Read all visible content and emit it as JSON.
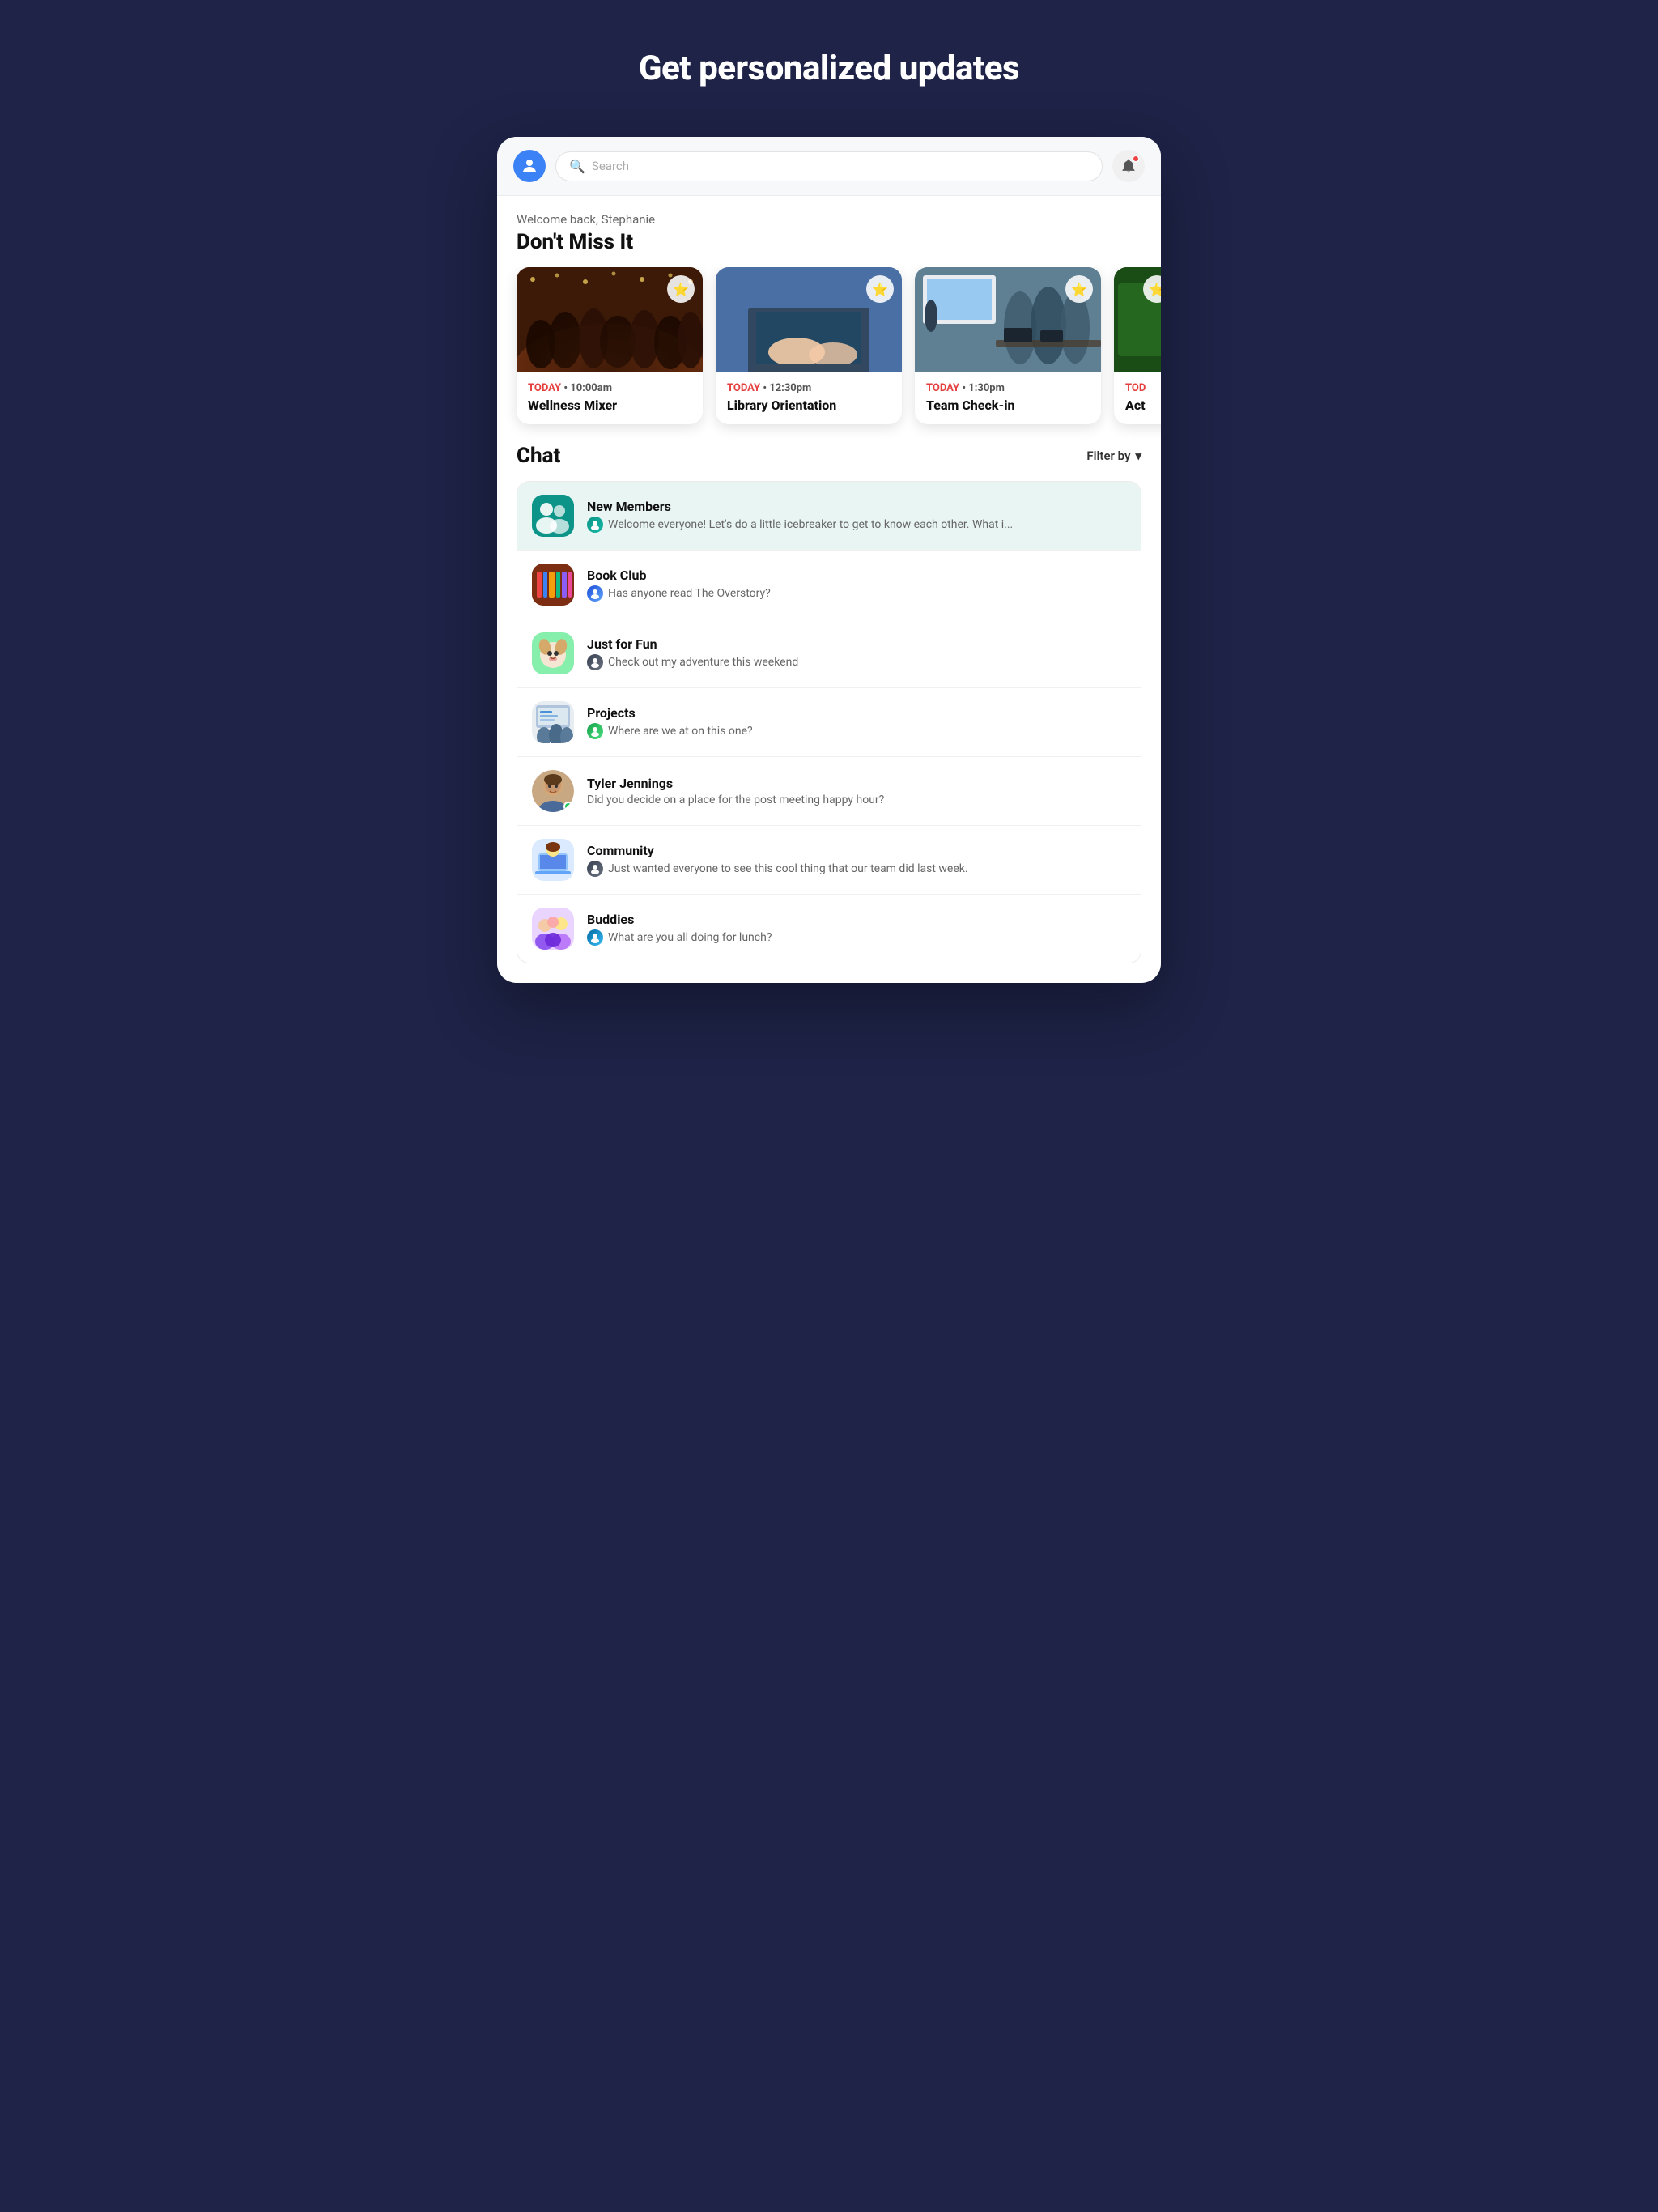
{
  "page": {
    "title": "Get personalized updates",
    "background_color": "#1e2347"
  },
  "header": {
    "search_placeholder": "Search",
    "welcome_text": "Welcome back, Stephanie",
    "section_title": "Don't Miss It"
  },
  "events": [
    {
      "id": "wellness",
      "time_label": "TODAY",
      "time_value": "10:00am",
      "name": "Wellness Mixer",
      "image_class": "img-crowd"
    },
    {
      "id": "library",
      "time_label": "TODAY",
      "time_value": "12:30pm",
      "name": "Library Orientation",
      "image_class": "img-laptop"
    },
    {
      "id": "teamcheckin",
      "time_label": "TODAY",
      "time_value": "1:30pm",
      "name": "Team Check-in",
      "image_class": "img-meeting"
    },
    {
      "id": "activity",
      "time_label": "TOD",
      "time_value": "",
      "name": "Act",
      "image_class": "img-partial"
    }
  ],
  "chat": {
    "title": "Chat",
    "filter_label": "Filter by",
    "items": [
      {
        "id": "new-members",
        "name": "New Members",
        "sub_label": "New Members",
        "preview": "Welcome everyone! Let's do a little icebreaker to get to know each other. What i...",
        "avatar_class": "av-newmembers",
        "active": true,
        "online": false,
        "avatar_symbol": "👥"
      },
      {
        "id": "book-club",
        "name": "Book Club",
        "sub_label": "",
        "preview": "Has anyone read The Overstory?",
        "avatar_class": "av-books",
        "active": false,
        "online": false,
        "avatar_symbol": "📚"
      },
      {
        "id": "just-for-fun",
        "name": "Just for Fun",
        "sub_label": "",
        "preview": "Check out my adventure this weekend",
        "avatar_class": "av-puppy",
        "active": false,
        "online": false,
        "avatar_symbol": "🐾"
      },
      {
        "id": "projects",
        "name": "Projects",
        "sub_label": "",
        "preview": "Where are we at on this one?",
        "avatar_class": "av-projects",
        "active": false,
        "online": false,
        "avatar_symbol": "📋"
      },
      {
        "id": "tyler-jennings",
        "name": "Tyler Jennings",
        "sub_label": "",
        "preview": "Did you decide on a place for the post meeting happy hour?",
        "avatar_class": "av-blue",
        "active": false,
        "online": true,
        "avatar_symbol": "👤"
      },
      {
        "id": "community",
        "name": "Community",
        "sub_label": "",
        "preview": "Just wanted everyone to see this cool thing that our team did last week.",
        "avatar_class": "av-community",
        "active": false,
        "online": false,
        "avatar_symbol": "🌐"
      },
      {
        "id": "buddies",
        "name": "Buddies",
        "sub_label": "",
        "preview": "What are you all doing for lunch?",
        "avatar_class": "av-buddies",
        "active": false,
        "online": false,
        "avatar_symbol": "🤝"
      }
    ]
  }
}
